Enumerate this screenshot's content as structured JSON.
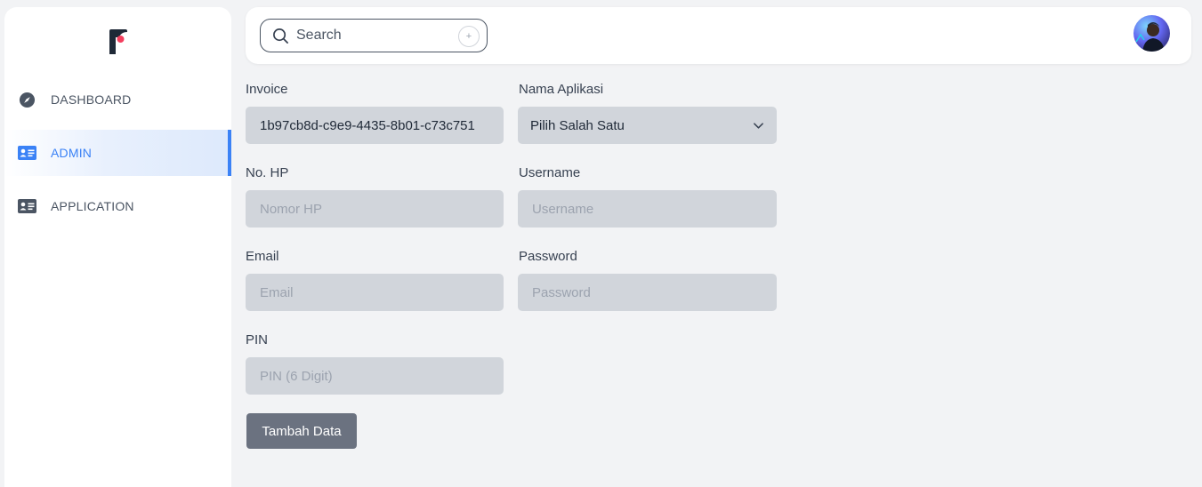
{
  "sidebar": {
    "items": [
      {
        "label": "DASHBOARD",
        "icon": "compass-icon"
      },
      {
        "label": "ADMIN",
        "icon": "id-card-icon",
        "active": true
      },
      {
        "label": "APPLICATION",
        "icon": "id-card-icon"
      }
    ]
  },
  "header": {
    "search": {
      "placeholder": "Search",
      "shortcut": "+"
    },
    "avatar_icon": "user-avatar"
  },
  "form": {
    "invoice": {
      "label": "Invoice",
      "value": "1b97cb8d-c9e9-4435-8b01-c73c751"
    },
    "app_name": {
      "label": "Nama Aplikasi",
      "value": "Pilih Salah Satu"
    },
    "phone": {
      "label": "No. HP",
      "placeholder": "Nomor HP"
    },
    "username": {
      "label": "Username",
      "placeholder": "Username"
    },
    "email": {
      "label": "Email",
      "placeholder": "Email"
    },
    "password": {
      "label": "Password",
      "placeholder": "Password"
    },
    "pin": {
      "label": "PIN",
      "placeholder": "PIN (6 Digit)"
    },
    "submit_label": "Tambah Data"
  },
  "colors": {
    "accent": "#3b82f6",
    "brand_logo": "#1f2937",
    "brand_dot": "#f43f5e",
    "field_bg": "#d1d5db",
    "button_bg": "#6b7280"
  }
}
